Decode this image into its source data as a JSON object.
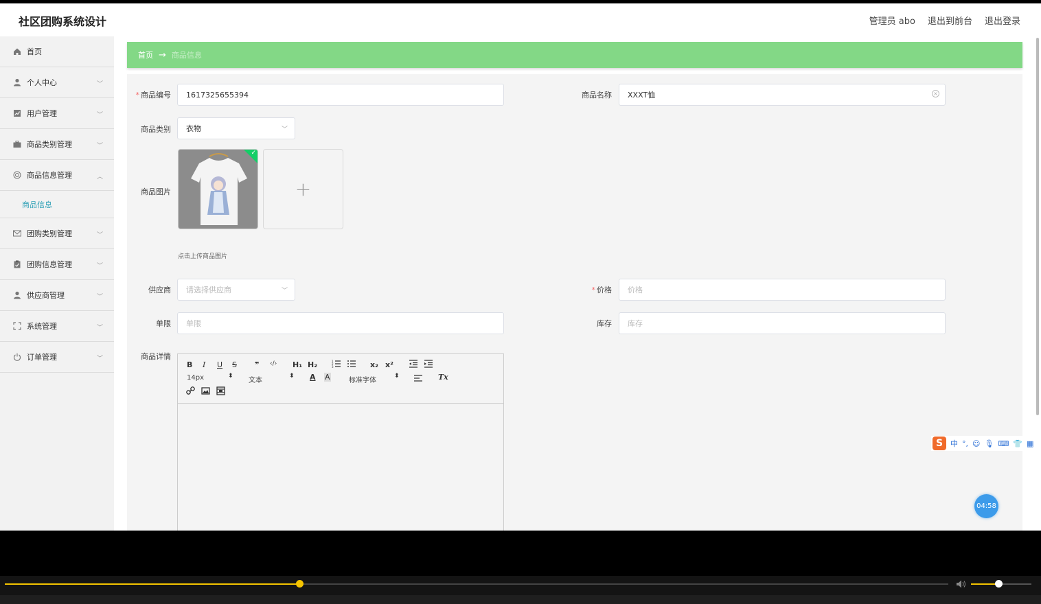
{
  "app": {
    "title": "社区团购系统设计"
  },
  "header": {
    "links": [
      "管理员 abo",
      "退出到前台",
      "退出登录"
    ]
  },
  "sidebar": {
    "items": [
      {
        "label": "首页",
        "icon": "home-icon",
        "expandable": false
      },
      {
        "label": "个人中心",
        "icon": "user-icon",
        "expandable": true
      },
      {
        "label": "用户管理",
        "icon": "chart-icon",
        "expandable": true
      },
      {
        "label": "商品类别管理",
        "icon": "briefcase-icon",
        "expandable": true
      },
      {
        "label": "商品信息管理",
        "icon": "target-icon",
        "expandable": true,
        "expanded": true
      },
      {
        "label": "团购类别管理",
        "icon": "mail-icon",
        "expandable": true
      },
      {
        "label": "团购信息管理",
        "icon": "clipboard-icon",
        "expandable": true
      },
      {
        "label": "供应商管理",
        "icon": "user-icon",
        "expandable": true
      },
      {
        "label": "系统管理",
        "icon": "fullscreen-icon",
        "expandable": true
      },
      {
        "label": "订单管理",
        "icon": "power-icon",
        "expandable": true
      }
    ],
    "sub_item": "商品信息"
  },
  "breadcrumb": {
    "home": "首页",
    "arrow": "→",
    "current": "商品信息"
  },
  "form": {
    "code": {
      "label": "商品编号",
      "value": "1617325655394"
    },
    "name": {
      "label": "商品名称",
      "value": "XXXT恤"
    },
    "category": {
      "label": "商品类别",
      "value": "衣物"
    },
    "image": {
      "label": "商品图片",
      "hint": "点击上传商品图片",
      "add_glyph": "+"
    },
    "supplier": {
      "label": "供应商",
      "placeholder": "请选择供应商"
    },
    "price": {
      "label": "价格",
      "placeholder": "价格"
    },
    "limit": {
      "label": "单限",
      "placeholder": "单限"
    },
    "stock": {
      "label": "库存",
      "placeholder": "库存"
    },
    "detail": {
      "label": "商品详情"
    }
  },
  "editor": {
    "size": "14px",
    "block": "文本",
    "font": "标准字体",
    "buttons": {
      "bold": "B",
      "italic": "I",
      "underline": "U",
      "strike": "S",
      "quote": "❞",
      "code": "‹/›",
      "h1": "H₁",
      "h2": "H₂",
      "sub": "x₂",
      "sup": "x²",
      "clean": "Tx"
    }
  },
  "player": {
    "progress": 0.312,
    "volume": 0.45
  },
  "timer": "04:58",
  "ime": {
    "mode": "中",
    "punct": "°,"
  }
}
